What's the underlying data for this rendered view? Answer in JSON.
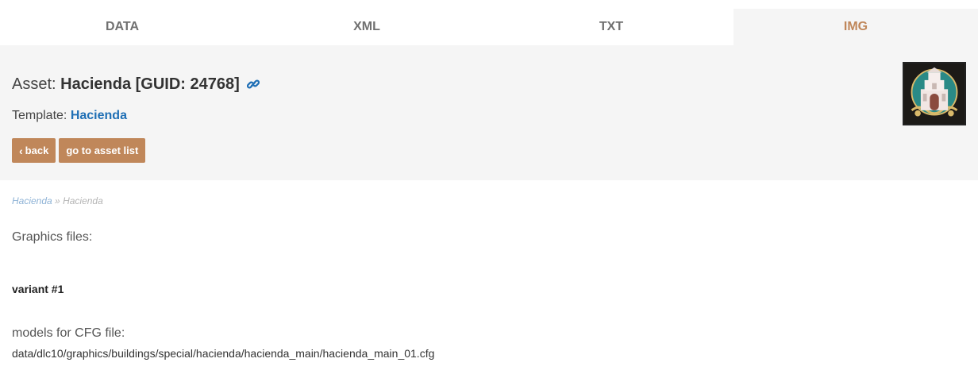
{
  "tabs": [
    {
      "label": "DATA",
      "active": false
    },
    {
      "label": "XML",
      "active": false
    },
    {
      "label": "TXT",
      "active": false
    },
    {
      "label": "IMG",
      "active": true
    }
  ],
  "header": {
    "asset_prefix": "Asset:",
    "asset_name": "Hacienda [GUID: 24768]",
    "link_icon": "link-icon",
    "template_prefix": "Template:",
    "template_name": "Hacienda",
    "back_label": "back",
    "asset_list_label": "go to asset list",
    "asset_image": "hacienda-building-icon"
  },
  "breadcrumb": {
    "items": [
      "Hacienda",
      "Hacienda"
    ],
    "separator": "»"
  },
  "content": {
    "graphics_label": "Graphics files:",
    "variant_label": "variant #1",
    "models_label": "models for CFG file:",
    "cfg_path": "data/dlc10/graphics/buildings/special/hacienda/hacienda_main/hacienda_main_01.cfg"
  },
  "colors": {
    "accent": "#c0875a",
    "link": "#1f6fb5",
    "panel_bg": "#f5f5f5"
  }
}
